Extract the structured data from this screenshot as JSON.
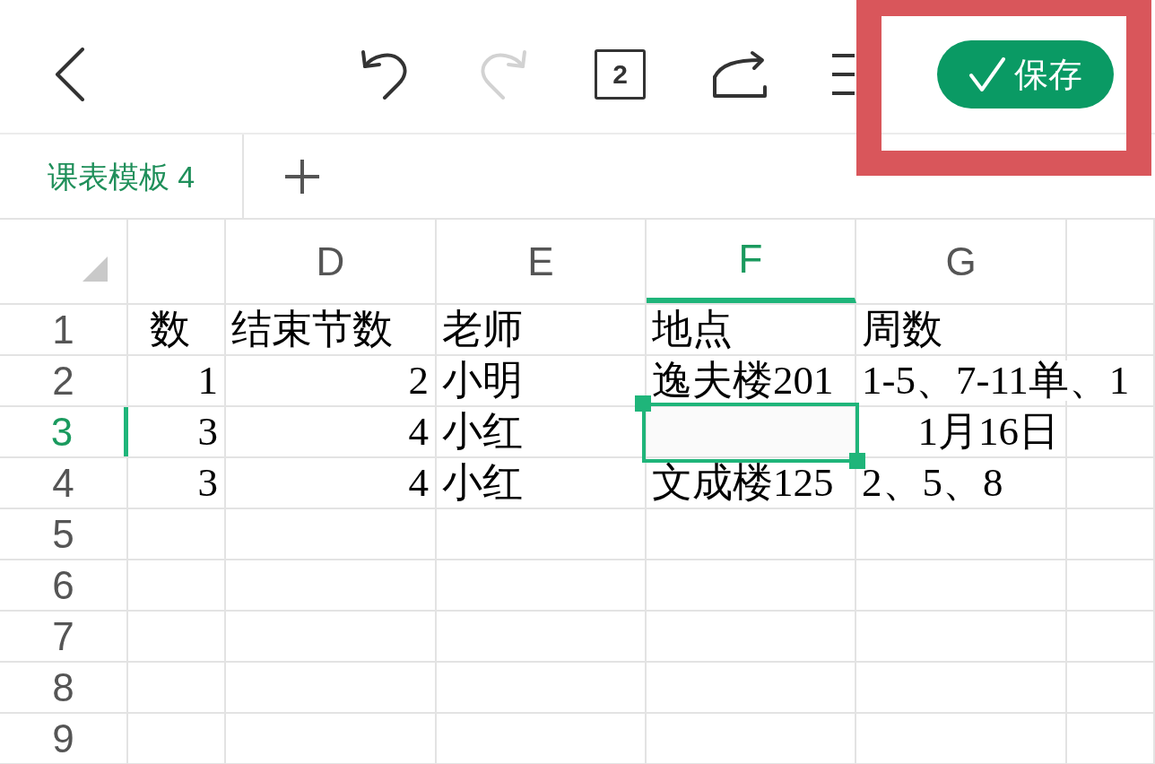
{
  "toolbar": {
    "actions": [
      {
        "kind": "back",
        "disabled": false
      },
      {
        "kind": "undo",
        "disabled": false
      },
      {
        "kind": "redo",
        "disabled": true
      },
      {
        "kind": "sheets",
        "label": "2",
        "disabled": false
      },
      {
        "kind": "share",
        "disabled": false
      },
      {
        "kind": "menu",
        "disabled": false
      }
    ],
    "save_button": {
      "label": "保存",
      "highlighted": true
    }
  },
  "sheet_tabs": [
    {
      "label": "课表模板 4",
      "selected": true
    }
  ],
  "grid": {
    "columns": [
      {
        "selected": false
      },
      {
        "label": "D",
        "selected": false
      },
      {
        "label": "E",
        "selected": false
      },
      {
        "label": "F",
        "selected": true
      },
      {
        "label": "G",
        "selected": false
      },
      {
        "selected": false
      }
    ],
    "rows": [
      {
        "label": "1",
        "selected": false,
        "cells": [
          {
            "kind": "text",
            "text": "数"
          },
          {
            "kind": "text",
            "text": "结束节数"
          },
          {
            "kind": "text",
            "text": "老师"
          },
          {
            "kind": "text",
            "text": "地点"
          },
          {
            "kind": "text",
            "text": "周数"
          }
        ]
      },
      {
        "label": "2",
        "selected": false,
        "cells": [
          {
            "kind": "number",
            "text": "1"
          },
          {
            "kind": "number",
            "text": "2"
          },
          {
            "kind": "text",
            "text": "小明"
          },
          {
            "kind": "text",
            "text": "逸夫楼201"
          },
          {
            "kind": "text",
            "text": "1-5、7-11单、1"
          }
        ]
      },
      {
        "label": "3",
        "selected": true,
        "cells": [
          {
            "kind": "number",
            "text": "3"
          },
          {
            "kind": "number",
            "text": "4"
          },
          {
            "kind": "text",
            "text": "小红"
          },
          null,
          {
            "kind": "date",
            "text": "1月16日"
          }
        ]
      },
      {
        "label": "4",
        "selected": false,
        "cells": [
          {
            "kind": "number",
            "text": "3"
          },
          {
            "kind": "number",
            "text": "4"
          },
          {
            "kind": "text",
            "text": "小红"
          },
          {
            "kind": "text",
            "text": "文成楼125"
          },
          {
            "kind": "text",
            "text": "2、5、8"
          }
        ]
      },
      {
        "label": "5",
        "selected": false
      },
      {
        "label": "6",
        "selected": false
      },
      {
        "label": "7",
        "selected": false
      },
      {
        "label": "8",
        "selected": false
      },
      {
        "label": "9",
        "selected": false
      }
    ]
  }
}
